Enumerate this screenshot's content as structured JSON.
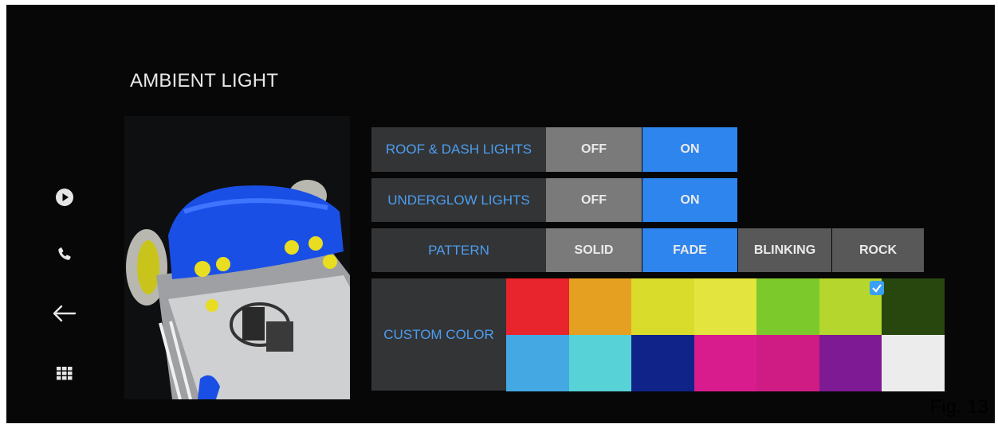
{
  "screen": {
    "title": "AMBIENT LIGHT"
  },
  "nav": [
    {
      "name": "play-icon"
    },
    {
      "name": "phone-icon"
    },
    {
      "name": "back-arrow-icon"
    },
    {
      "name": "grid-menu-icon"
    }
  ],
  "rows": {
    "roof": {
      "label": "ROOF & DASH LIGHTS",
      "off": "OFF",
      "on": "ON",
      "selected": "ON"
    },
    "underglow": {
      "label": "UNDERGLOW LIGHTS",
      "off": "OFF",
      "on": "ON",
      "selected": "ON"
    },
    "pattern": {
      "label": "PATTERN",
      "options": [
        "SOLID",
        "FADE",
        "BLINKING",
        "ROCK"
      ],
      "selected": "FADE"
    },
    "custom_color": {
      "label": "CUSTOM COLOR",
      "selected_index": 5,
      "colors": [
        "#e8242c",
        "#e6a021",
        "#dadc2c",
        "#e3e43d",
        "#7cc92c",
        "#b5d62d",
        "#28470f",
        "#44a9e3",
        "#57d2d6",
        "#102389",
        "#d81c8e",
        "#cf1c84",
        "#7e1a93",
        "#ececec"
      ]
    }
  },
  "caption": "Fig. 13",
  "colors": {
    "accent": "#2f85ee",
    "label_text": "#4d9ef0",
    "background": "#070707"
  }
}
